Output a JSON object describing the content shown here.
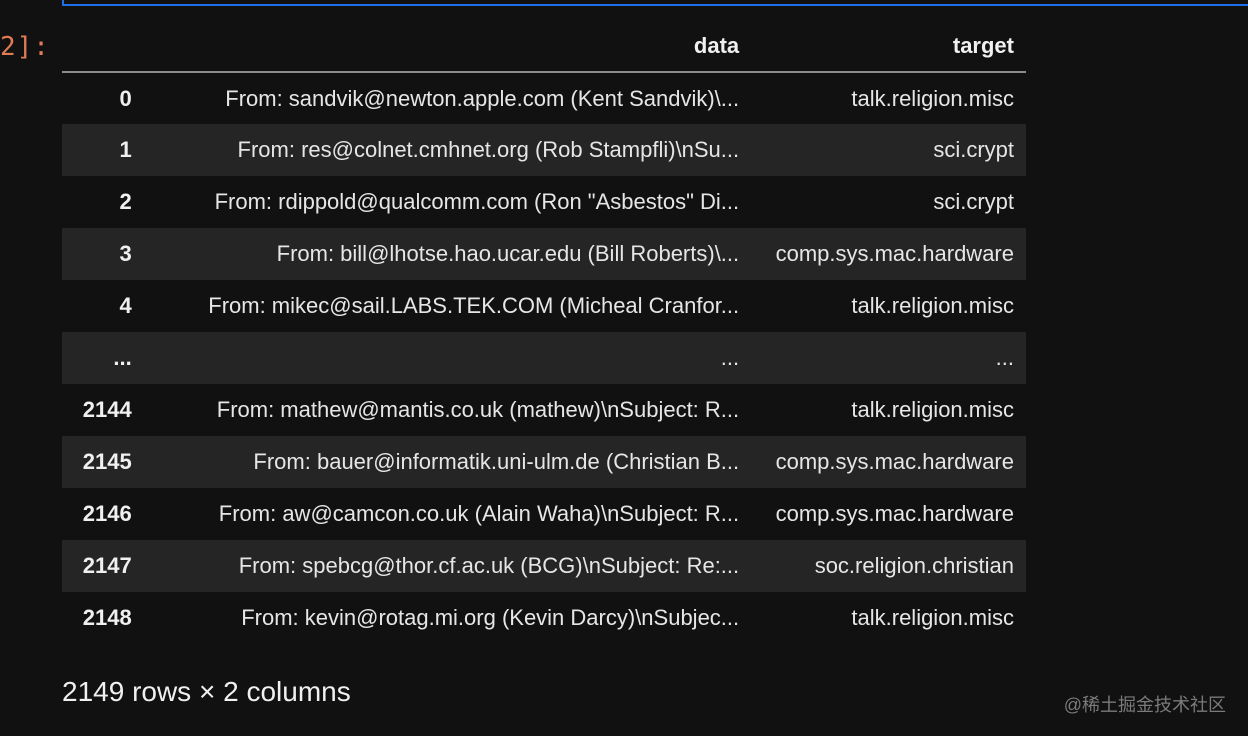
{
  "prompt": {
    "label": "2]:"
  },
  "table": {
    "columns": [
      "data",
      "target"
    ],
    "rows": [
      {
        "index": "0",
        "data": "From: sandvik@newton.apple.com (Kent Sandvik)\\...",
        "target": "talk.religion.misc"
      },
      {
        "index": "1",
        "data": "From: res@colnet.cmhnet.org (Rob Stampfli)\\nSu...",
        "target": "sci.crypt"
      },
      {
        "index": "2",
        "data": "From: rdippold@qualcomm.com (Ron \"Asbestos\" Di...",
        "target": "sci.crypt"
      },
      {
        "index": "3",
        "data": "From: bill@lhotse.hao.ucar.edu (Bill Roberts)\\...",
        "target": "comp.sys.mac.hardware"
      },
      {
        "index": "4",
        "data": "From: mikec@sail.LABS.TEK.COM (Micheal Cranfor...",
        "target": "talk.religion.misc"
      },
      {
        "index": "...",
        "data": "...",
        "target": "..."
      },
      {
        "index": "2144",
        "data": "From: mathew@mantis.co.uk (mathew)\\nSubject: R...",
        "target": "talk.religion.misc"
      },
      {
        "index": "2145",
        "data": "From: bauer@informatik.uni-ulm.de (Christian B...",
        "target": "comp.sys.mac.hardware"
      },
      {
        "index": "2146",
        "data": "From: aw@camcon.co.uk (Alain Waha)\\nSubject: R...",
        "target": "comp.sys.mac.hardware"
      },
      {
        "index": "2147",
        "data": "From: spebcg@thor.cf.ac.uk (BCG)\\nSubject: Re:...",
        "target": "soc.religion.christian"
      },
      {
        "index": "2148",
        "data": "From: kevin@rotag.mi.org (Kevin Darcy)\\nSubjec...",
        "target": "talk.religion.misc"
      }
    ]
  },
  "shape_note": "2149 rows × 2 columns",
  "watermark": "@稀土掘金技术社区",
  "colors": {
    "background": "#111111",
    "prompt": "#e07b53",
    "cell_border": "#1f6feb",
    "striped_row": "#252525"
  }
}
